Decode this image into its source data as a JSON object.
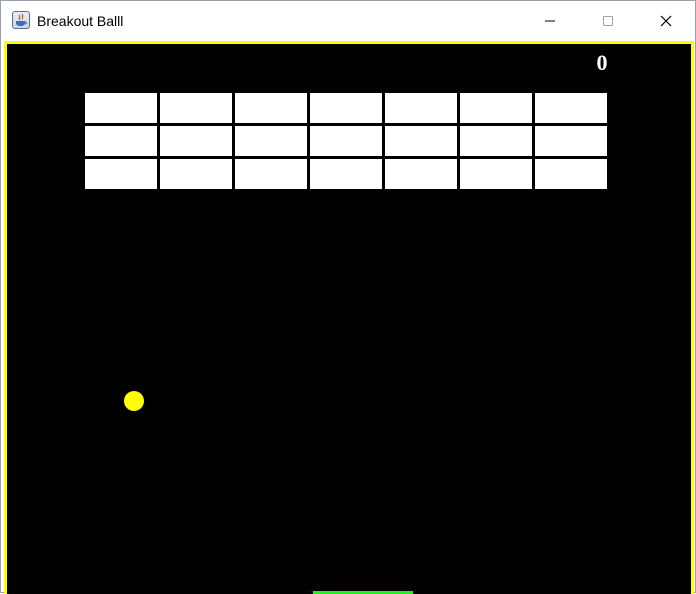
{
  "window": {
    "title": "Breakout Balll",
    "app_icon": "java-icon",
    "controls": {
      "minimize_icon": "minimize-icon",
      "maximize_icon": "maximize-icon",
      "close_icon": "close-icon"
    }
  },
  "game": {
    "score": "0",
    "brick_rows": 3,
    "brick_columns": 7,
    "colors": {
      "background": "#000000",
      "border": "#ffff00",
      "brick": "#ffffff",
      "ball": "#ffff00",
      "paddle": "#22ee22",
      "score": "#ffffff"
    }
  }
}
